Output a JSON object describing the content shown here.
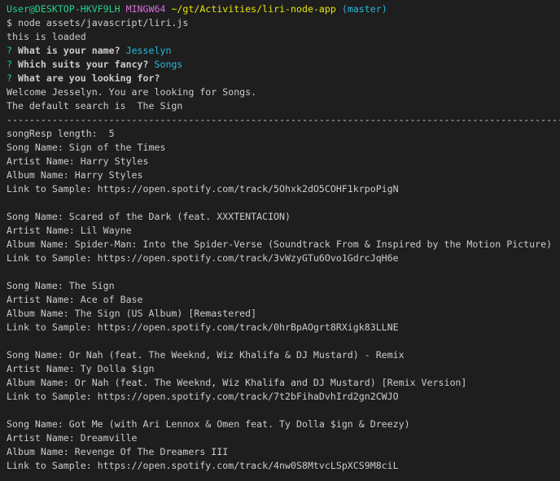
{
  "colors": {
    "background": "#1e1e1e",
    "text": "#cccccc",
    "green": "#23d18b",
    "magenta": "#d670d6",
    "yellow": "#e5e510",
    "cyan": "#29b8db",
    "prompt": "#23d18b"
  },
  "terminal": {
    "lines": [
      [
        {
          "t": "User@DESKTOP-HKVF9LH",
          "c": "green"
        },
        {
          "t": " "
        },
        {
          "t": "MINGW64",
          "c": "magenta"
        },
        {
          "t": " "
        },
        {
          "t": "~/gt/Activities/liri-node-app",
          "c": "yellow"
        },
        {
          "t": " "
        },
        {
          "t": "(master)",
          "c": "cyan"
        }
      ],
      [
        {
          "t": "$ node assets/javascript/liri.js"
        }
      ],
      [
        {
          "t": "this is loaded"
        }
      ],
      [
        {
          "t": "? ",
          "c": "green"
        },
        {
          "t": "What is your name? ",
          "b": true
        },
        {
          "t": "Jesselyn",
          "c": "cyan"
        }
      ],
      [
        {
          "t": "? ",
          "c": "green"
        },
        {
          "t": "Which suits your fancy? ",
          "b": true
        },
        {
          "t": "Songs",
          "c": "cyan"
        }
      ],
      [
        {
          "t": "? ",
          "c": "green"
        },
        {
          "t": "What are you looking for?",
          "b": true
        }
      ],
      [
        {
          "t": "Welcome Jesselyn. You are looking for Songs."
        }
      ],
      [
        {
          "t": "The default search is  The Sign"
        }
      ],
      [
        {
          "t": "----------------------------------------------------------------------------------------------------------",
          "sep": true
        }
      ],
      [
        {
          "t": "songResp length:  5"
        }
      ],
      [
        {
          "t": "Song Name: Sign of the Times"
        }
      ],
      [
        {
          "t": "Artist Name: Harry Styles"
        }
      ],
      [
        {
          "t": "Album Name: Harry Styles"
        }
      ],
      [
        {
          "t": "Link to Sample: https://open.spotify.com/track/5Ohxk2dO5COHF1krpoPigN"
        }
      ],
      [],
      [
        {
          "t": "Song Name: Scared of the Dark (feat. XXXTENTACION)"
        }
      ],
      [
        {
          "t": "Artist Name: Lil Wayne"
        }
      ],
      [
        {
          "t": "Album Name: Spider-Man: Into the Spider-Verse (Soundtrack From & Inspired by the Motion Picture)"
        }
      ],
      [
        {
          "t": "Link to Sample: https://open.spotify.com/track/3vWzyGTu6Ovo1GdrcJqH6e"
        }
      ],
      [],
      [
        {
          "t": "Song Name: The Sign"
        }
      ],
      [
        {
          "t": "Artist Name: Ace of Base"
        }
      ],
      [
        {
          "t": "Album Name: The Sign (US Album) [Remastered]"
        }
      ],
      [
        {
          "t": "Link to Sample: https://open.spotify.com/track/0hrBpAOgrt8RXigk83LLNE"
        }
      ],
      [],
      [
        {
          "t": "Song Name: Or Nah (feat. The Weeknd, Wiz Khalifa & DJ Mustard) - Remix"
        }
      ],
      [
        {
          "t": "Artist Name: Ty Dolla $ign"
        }
      ],
      [
        {
          "t": "Album Name: Or Nah (feat. The Weeknd, Wiz Khalifa and DJ Mustard) [Remix Version]"
        }
      ],
      [
        {
          "t": "Link to Sample: https://open.spotify.com/track/7t2bFihaDvhIrd2gn2CWJO"
        }
      ],
      [],
      [
        {
          "t": "Song Name: Got Me (with Ari Lennox & Omen feat. Ty Dolla $ign & Dreezy)"
        }
      ],
      [
        {
          "t": "Artist Name: Dreamville"
        }
      ],
      [
        {
          "t": "Album Name: Revenge Of The Dreamers III"
        }
      ],
      [
        {
          "t": "Link to Sample: https://open.spotify.com/track/4nw0S8MtvcLSpXCS9M8ciL"
        }
      ]
    ]
  }
}
